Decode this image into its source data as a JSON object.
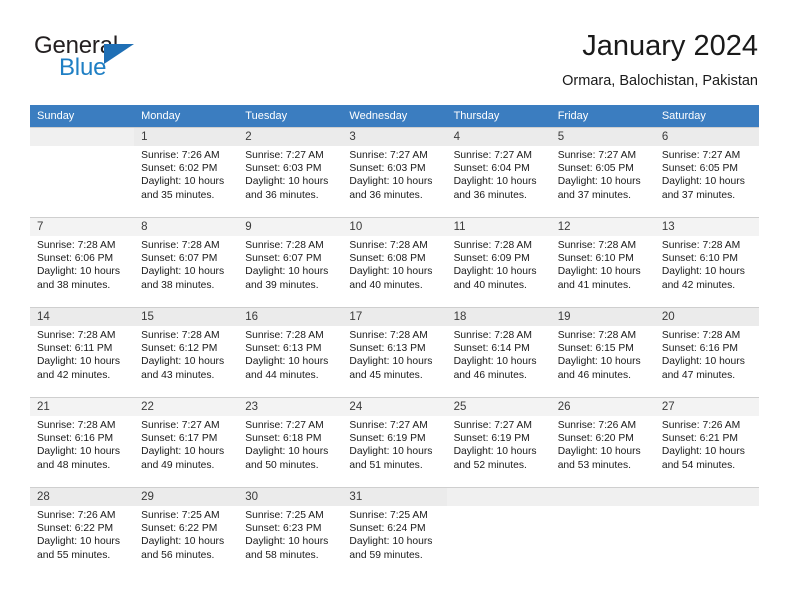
{
  "brand": {
    "word_one": "General",
    "word_two": "Blue",
    "logo_icon": "triangle-logo-icon",
    "accent_color": "#1f6fb5"
  },
  "header": {
    "title": "January 2024",
    "subtitle": "Ormara, Balochistan, Pakistan"
  },
  "calendar": {
    "header_background": "#3b7dc0",
    "weekdays": [
      "Sunday",
      "Monday",
      "Tuesday",
      "Wednesday",
      "Thursday",
      "Friday",
      "Saturday"
    ],
    "weeks": [
      [
        {
          "day": "",
          "sunrise": "",
          "sunset": "",
          "daylight_line1": "",
          "daylight_line2": ""
        },
        {
          "day": "1",
          "sunrise": "Sunrise: 7:26 AM",
          "sunset": "Sunset: 6:02 PM",
          "daylight_line1": "Daylight: 10 hours",
          "daylight_line2": "and 35 minutes."
        },
        {
          "day": "2",
          "sunrise": "Sunrise: 7:27 AM",
          "sunset": "Sunset: 6:03 PM",
          "daylight_line1": "Daylight: 10 hours",
          "daylight_line2": "and 36 minutes."
        },
        {
          "day": "3",
          "sunrise": "Sunrise: 7:27 AM",
          "sunset": "Sunset: 6:03 PM",
          "daylight_line1": "Daylight: 10 hours",
          "daylight_line2": "and 36 minutes."
        },
        {
          "day": "4",
          "sunrise": "Sunrise: 7:27 AM",
          "sunset": "Sunset: 6:04 PM",
          "daylight_line1": "Daylight: 10 hours",
          "daylight_line2": "and 36 minutes."
        },
        {
          "day": "5",
          "sunrise": "Sunrise: 7:27 AM",
          "sunset": "Sunset: 6:05 PM",
          "daylight_line1": "Daylight: 10 hours",
          "daylight_line2": "and 37 minutes."
        },
        {
          "day": "6",
          "sunrise": "Sunrise: 7:27 AM",
          "sunset": "Sunset: 6:05 PM",
          "daylight_line1": "Daylight: 10 hours",
          "daylight_line2": "and 37 minutes."
        }
      ],
      [
        {
          "day": "7",
          "sunrise": "Sunrise: 7:28 AM",
          "sunset": "Sunset: 6:06 PM",
          "daylight_line1": "Daylight: 10 hours",
          "daylight_line2": "and 38 minutes."
        },
        {
          "day": "8",
          "sunrise": "Sunrise: 7:28 AM",
          "sunset": "Sunset: 6:07 PM",
          "daylight_line1": "Daylight: 10 hours",
          "daylight_line2": "and 38 minutes."
        },
        {
          "day": "9",
          "sunrise": "Sunrise: 7:28 AM",
          "sunset": "Sunset: 6:07 PM",
          "daylight_line1": "Daylight: 10 hours",
          "daylight_line2": "and 39 minutes."
        },
        {
          "day": "10",
          "sunrise": "Sunrise: 7:28 AM",
          "sunset": "Sunset: 6:08 PM",
          "daylight_line1": "Daylight: 10 hours",
          "daylight_line2": "and 40 minutes."
        },
        {
          "day": "11",
          "sunrise": "Sunrise: 7:28 AM",
          "sunset": "Sunset: 6:09 PM",
          "daylight_line1": "Daylight: 10 hours",
          "daylight_line2": "and 40 minutes."
        },
        {
          "day": "12",
          "sunrise": "Sunrise: 7:28 AM",
          "sunset": "Sunset: 6:10 PM",
          "daylight_line1": "Daylight: 10 hours",
          "daylight_line2": "and 41 minutes."
        },
        {
          "day": "13",
          "sunrise": "Sunrise: 7:28 AM",
          "sunset": "Sunset: 6:10 PM",
          "daylight_line1": "Daylight: 10 hours",
          "daylight_line2": "and 42 minutes."
        }
      ],
      [
        {
          "day": "14",
          "sunrise": "Sunrise: 7:28 AM",
          "sunset": "Sunset: 6:11 PM",
          "daylight_line1": "Daylight: 10 hours",
          "daylight_line2": "and 42 minutes."
        },
        {
          "day": "15",
          "sunrise": "Sunrise: 7:28 AM",
          "sunset": "Sunset: 6:12 PM",
          "daylight_line1": "Daylight: 10 hours",
          "daylight_line2": "and 43 minutes."
        },
        {
          "day": "16",
          "sunrise": "Sunrise: 7:28 AM",
          "sunset": "Sunset: 6:13 PM",
          "daylight_line1": "Daylight: 10 hours",
          "daylight_line2": "and 44 minutes."
        },
        {
          "day": "17",
          "sunrise": "Sunrise: 7:28 AM",
          "sunset": "Sunset: 6:13 PM",
          "daylight_line1": "Daylight: 10 hours",
          "daylight_line2": "and 45 minutes."
        },
        {
          "day": "18",
          "sunrise": "Sunrise: 7:28 AM",
          "sunset": "Sunset: 6:14 PM",
          "daylight_line1": "Daylight: 10 hours",
          "daylight_line2": "and 46 minutes."
        },
        {
          "day": "19",
          "sunrise": "Sunrise: 7:28 AM",
          "sunset": "Sunset: 6:15 PM",
          "daylight_line1": "Daylight: 10 hours",
          "daylight_line2": "and 46 minutes."
        },
        {
          "day": "20",
          "sunrise": "Sunrise: 7:28 AM",
          "sunset": "Sunset: 6:16 PM",
          "daylight_line1": "Daylight: 10 hours",
          "daylight_line2": "and 47 minutes."
        }
      ],
      [
        {
          "day": "21",
          "sunrise": "Sunrise: 7:28 AM",
          "sunset": "Sunset: 6:16 PM",
          "daylight_line1": "Daylight: 10 hours",
          "daylight_line2": "and 48 minutes."
        },
        {
          "day": "22",
          "sunrise": "Sunrise: 7:27 AM",
          "sunset": "Sunset: 6:17 PM",
          "daylight_line1": "Daylight: 10 hours",
          "daylight_line2": "and 49 minutes."
        },
        {
          "day": "23",
          "sunrise": "Sunrise: 7:27 AM",
          "sunset": "Sunset: 6:18 PM",
          "daylight_line1": "Daylight: 10 hours",
          "daylight_line2": "and 50 minutes."
        },
        {
          "day": "24",
          "sunrise": "Sunrise: 7:27 AM",
          "sunset": "Sunset: 6:19 PM",
          "daylight_line1": "Daylight: 10 hours",
          "daylight_line2": "and 51 minutes."
        },
        {
          "day": "25",
          "sunrise": "Sunrise: 7:27 AM",
          "sunset": "Sunset: 6:19 PM",
          "daylight_line1": "Daylight: 10 hours",
          "daylight_line2": "and 52 minutes."
        },
        {
          "day": "26",
          "sunrise": "Sunrise: 7:26 AM",
          "sunset": "Sunset: 6:20 PM",
          "daylight_line1": "Daylight: 10 hours",
          "daylight_line2": "and 53 minutes."
        },
        {
          "day": "27",
          "sunrise": "Sunrise: 7:26 AM",
          "sunset": "Sunset: 6:21 PM",
          "daylight_line1": "Daylight: 10 hours",
          "daylight_line2": "and 54 minutes."
        }
      ],
      [
        {
          "day": "28",
          "sunrise": "Sunrise: 7:26 AM",
          "sunset": "Sunset: 6:22 PM",
          "daylight_line1": "Daylight: 10 hours",
          "daylight_line2": "and 55 minutes."
        },
        {
          "day": "29",
          "sunrise": "Sunrise: 7:25 AM",
          "sunset": "Sunset: 6:22 PM",
          "daylight_line1": "Daylight: 10 hours",
          "daylight_line2": "and 56 minutes."
        },
        {
          "day": "30",
          "sunrise": "Sunrise: 7:25 AM",
          "sunset": "Sunset: 6:23 PM",
          "daylight_line1": "Daylight: 10 hours",
          "daylight_line2": "and 58 minutes."
        },
        {
          "day": "31",
          "sunrise": "Sunrise: 7:25 AM",
          "sunset": "Sunset: 6:24 PM",
          "daylight_line1": "Daylight: 10 hours",
          "daylight_line2": "and 59 minutes."
        },
        {
          "day": "",
          "sunrise": "",
          "sunset": "",
          "daylight_line1": "",
          "daylight_line2": ""
        },
        {
          "day": "",
          "sunrise": "",
          "sunset": "",
          "daylight_line1": "",
          "daylight_line2": ""
        },
        {
          "day": "",
          "sunrise": "",
          "sunset": "",
          "daylight_line1": "",
          "daylight_line2": ""
        }
      ]
    ]
  }
}
